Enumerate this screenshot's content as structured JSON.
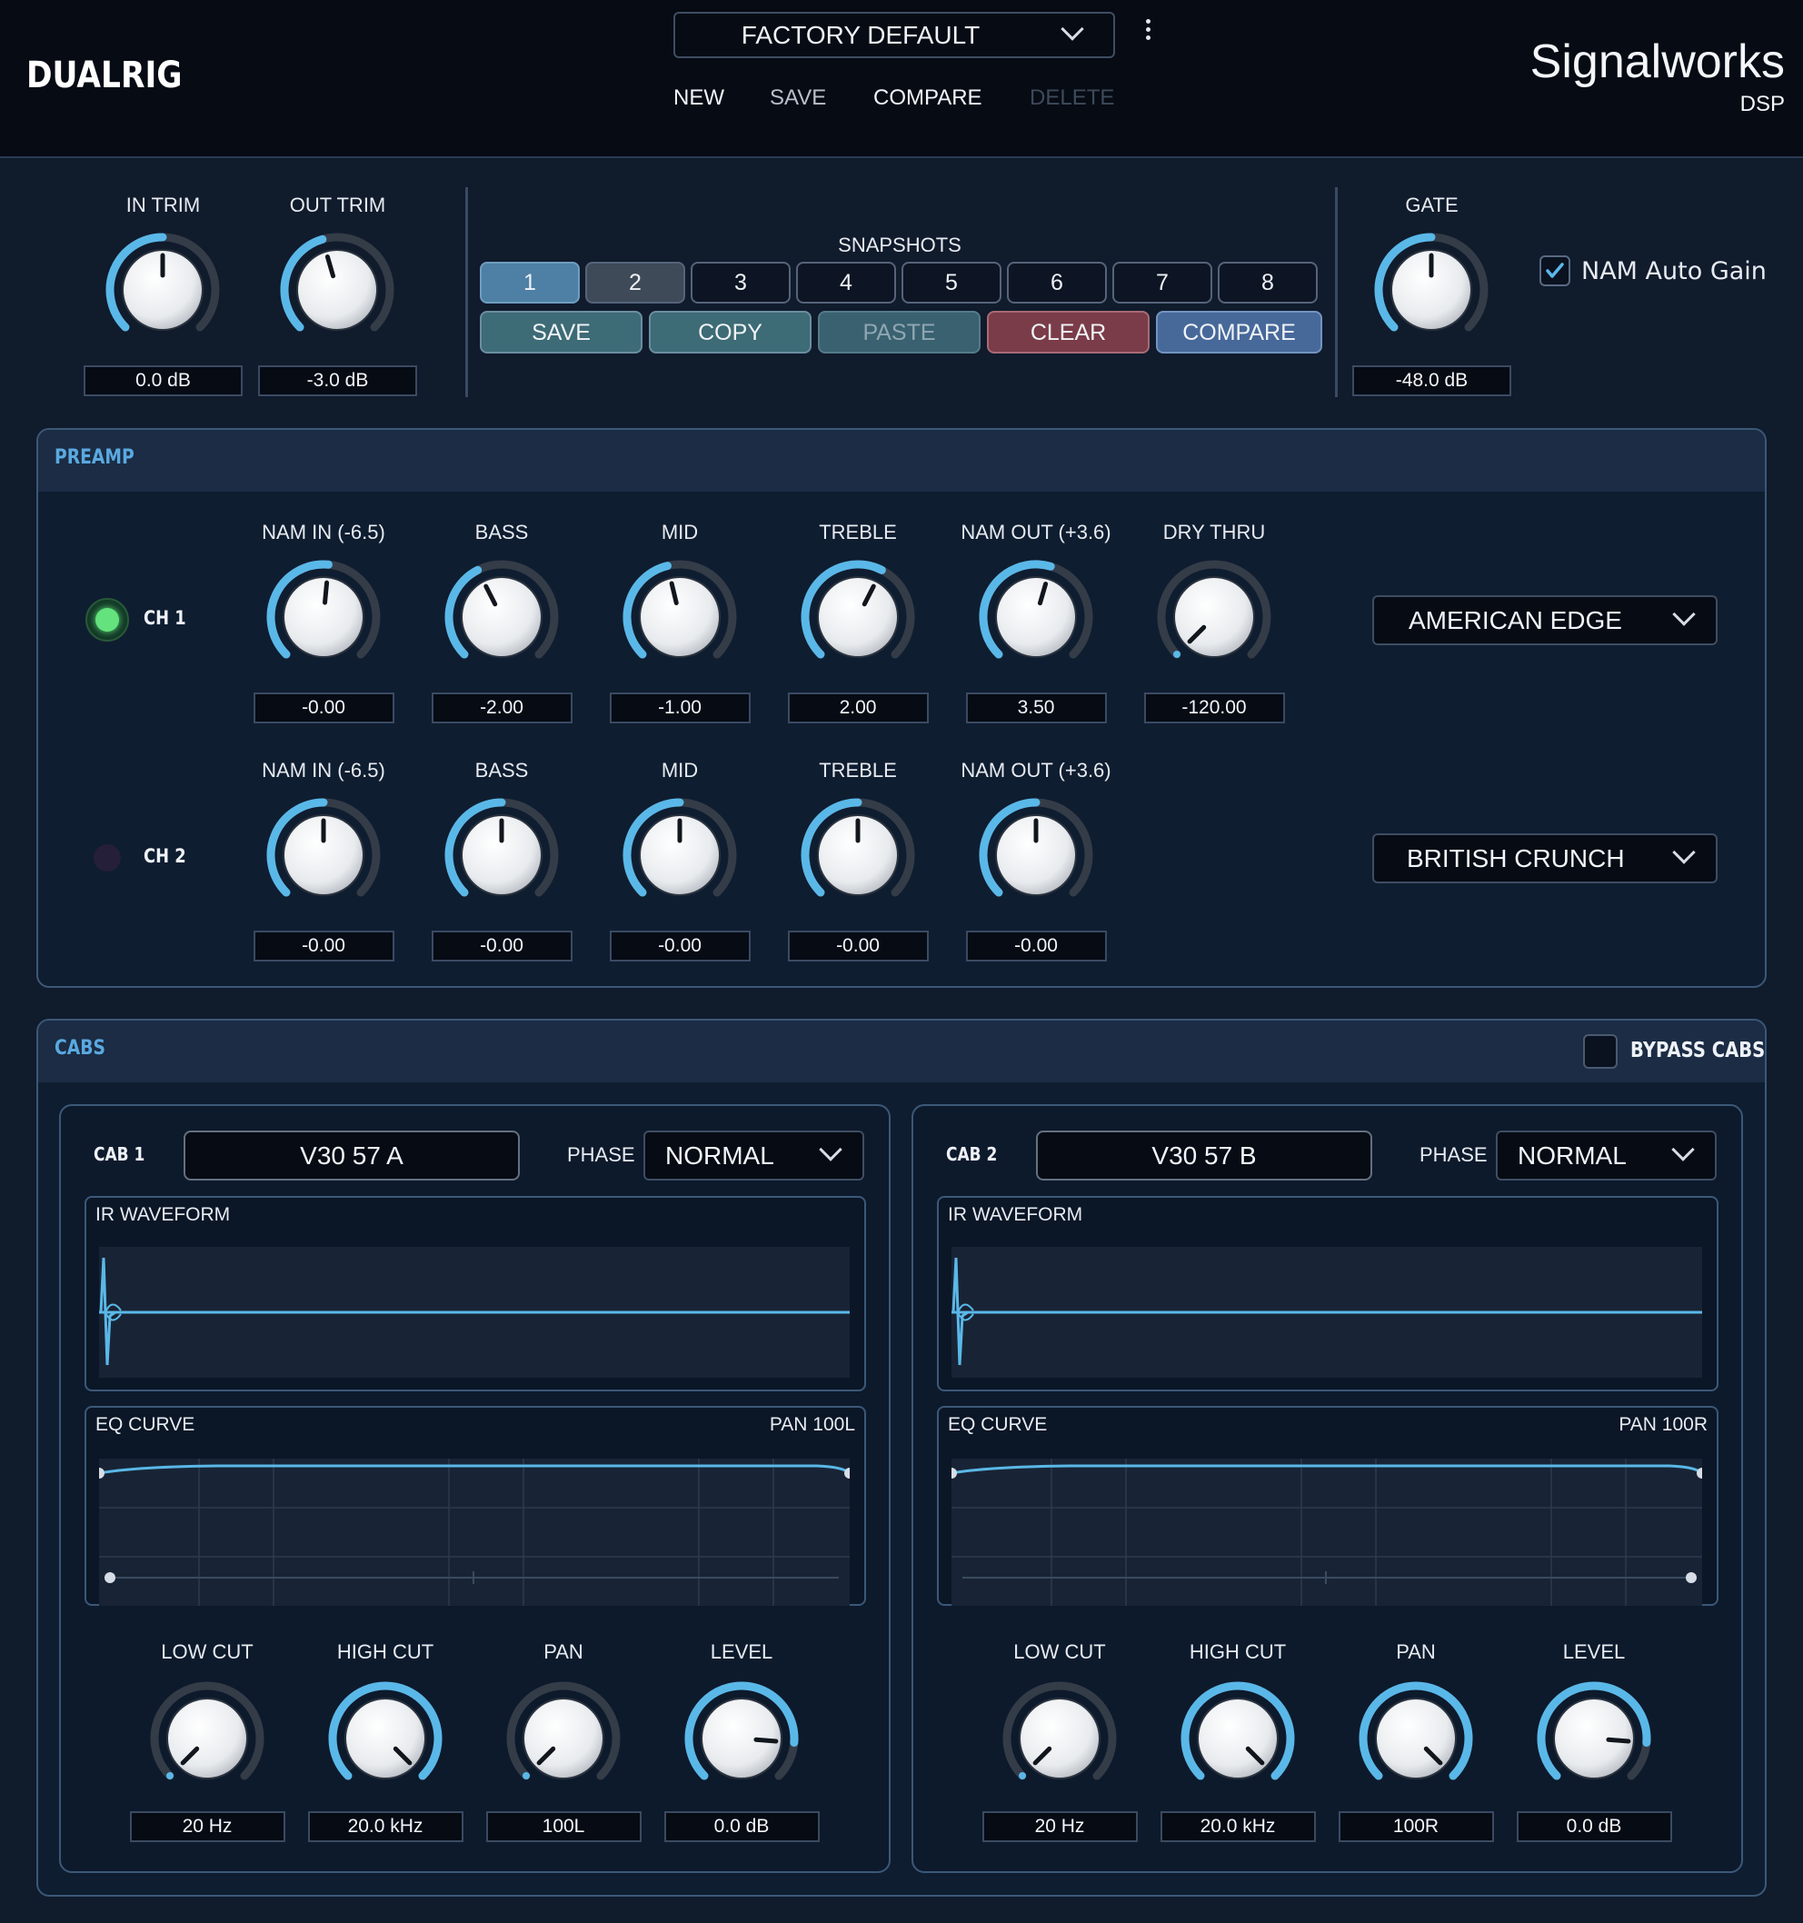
{
  "app": {
    "brand": "DUALRIG",
    "company": "Signalworks",
    "company_sub": "DSP"
  },
  "preset": {
    "name": "FACTORY DEFAULT",
    "buttons": {
      "new": "NEW",
      "save": "SAVE",
      "compare": "COMPARE",
      "delete": "DELETE"
    }
  },
  "io": {
    "in_trim": {
      "label": "IN TRIM",
      "value": "0.0 dB",
      "level": 0.5
    },
    "out_trim": {
      "label": "OUT TRIM",
      "value": "-3.0 dB",
      "level": 0.44
    },
    "gate": {
      "label": "GATE",
      "value": "-48.0 dB",
      "level": 0.5
    },
    "nam_auto_gain": {
      "label": "NAM Auto Gain",
      "checked": true
    }
  },
  "snapshots": {
    "title": "SNAPSHOTS",
    "slots": [
      "1",
      "2",
      "3",
      "4",
      "5",
      "6",
      "7",
      "8"
    ],
    "active": "1",
    "actions": {
      "save": "SAVE",
      "copy": "COPY",
      "paste": "PASTE",
      "clear": "CLEAR",
      "compare": "COMPARE"
    }
  },
  "preamp": {
    "title": "PREAMP",
    "ch1": {
      "label": "CH 1",
      "active": true,
      "amp": "AMERICAN EDGE",
      "knobs": [
        {
          "label": "NAM IN (-6.5)",
          "value": "-0.00",
          "level": 0.52
        },
        {
          "label": "BASS",
          "value": "-2.00",
          "level": 0.4
        },
        {
          "label": "MID",
          "value": "-1.00",
          "level": 0.45
        },
        {
          "label": "TREBLE",
          "value": "2.00",
          "level": 0.6
        },
        {
          "label": "NAM OUT (+3.6)",
          "value": "3.50",
          "level": 0.56
        },
        {
          "label": "DRY THRU",
          "value": "-120.00",
          "level": 0.0
        }
      ]
    },
    "ch2": {
      "label": "CH 2",
      "active": false,
      "amp": "BRITISH CRUNCH",
      "knobs": [
        {
          "label": "NAM IN (-6.5)",
          "value": "-0.00",
          "level": 0.5
        },
        {
          "label": "BASS",
          "value": "-0.00",
          "level": 0.5
        },
        {
          "label": "MID",
          "value": "-0.00",
          "level": 0.5
        },
        {
          "label": "TREBLE",
          "value": "-0.00",
          "level": 0.5
        },
        {
          "label": "NAM OUT (+3.6)",
          "value": "-0.00",
          "level": 0.5
        }
      ]
    }
  },
  "cabs": {
    "title": "CABS",
    "bypass_label": "BYPASS CABS",
    "bypass_checked": false,
    "phase_label": "PHASE",
    "ir_label": "IR WAVEFORM",
    "eq_label": "EQ CURVE",
    "cab1": {
      "label": "CAB 1",
      "ir": "V30 57 A",
      "phase": "NORMAL",
      "pan_tag": "PAN 100L",
      "knobs": [
        {
          "label": "LOW CUT",
          "value": "20 Hz",
          "level": 0.0
        },
        {
          "label": "HIGH CUT",
          "value": "20.0 kHz",
          "level": 1.0
        },
        {
          "label": "PAN",
          "value": "100L",
          "level": 0.0
        },
        {
          "label": "LEVEL",
          "value": "0.0 dB",
          "level": 0.85
        }
      ]
    },
    "cab2": {
      "label": "CAB 2",
      "ir": "V30 57 B",
      "phase": "NORMAL",
      "pan_tag": "PAN 100R",
      "knobs": [
        {
          "label": "LOW CUT",
          "value": "20 Hz",
          "level": 0.0
        },
        {
          "label": "HIGH CUT",
          "value": "20.0 kHz",
          "level": 1.0
        },
        {
          "label": "PAN",
          "value": "100R",
          "level": 1.0
        },
        {
          "label": "LEVEL",
          "value": "0.0 dB",
          "level": 0.85
        }
      ]
    }
  },
  "colors": {
    "accent": "#5ab8e8",
    "track": "#343c48",
    "panel_title": "#5aa9e0",
    "led_on": "#5ee07a",
    "led_off": "#2a2440"
  }
}
